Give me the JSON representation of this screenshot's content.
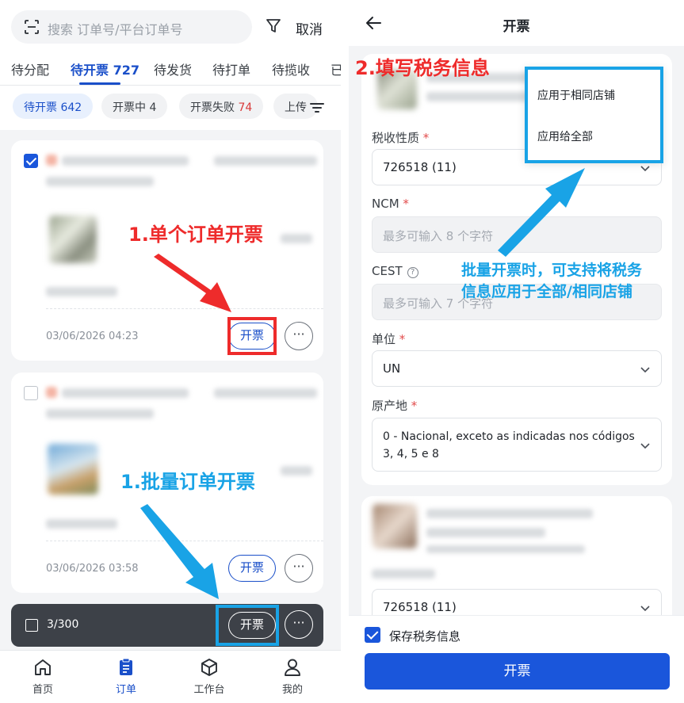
{
  "left": {
    "search": {
      "placeholder": "搜索 订单号/平台订单号",
      "cancel_label": "取消"
    },
    "tabs": [
      {
        "label": "待分配"
      },
      {
        "label": "待开票 727",
        "active": true
      },
      {
        "label": "待发货"
      },
      {
        "label": "待打单"
      },
      {
        "label": "待揽收"
      },
      {
        "label": "已"
      }
    ],
    "chips": [
      {
        "label": "待开票 642",
        "active": true
      },
      {
        "label": "开票中 4"
      },
      {
        "label": "开票失败",
        "count": "74"
      },
      {
        "label": "上传"
      }
    ],
    "orders": [
      {
        "time": "03/06/2026 04:23",
        "invoice_label": "开票",
        "more_label": "···",
        "checked": true
      },
      {
        "time": "03/06/2026 03:58",
        "invoice_label": "开票",
        "more_label": "···",
        "checked": false
      }
    ],
    "batch_bar": {
      "count": "3/300",
      "invoice_label": "开票",
      "more_label": "···"
    },
    "bottom_nav": [
      {
        "label": "首页",
        "icon": "home-icon"
      },
      {
        "label": "订单",
        "icon": "order-icon",
        "active": true
      },
      {
        "label": "工作台",
        "icon": "workbench-icon"
      },
      {
        "label": "我的",
        "icon": "profile-icon"
      }
    ],
    "annotations": {
      "single": "1.单个订单开票",
      "batch": "1.批量订单开票"
    }
  },
  "right": {
    "title": "开票",
    "annotation_title": "2.填写税务信息",
    "annotation_note_line1": "批量开票时，可支持将税务",
    "annotation_note_line2": "信息应用于全部/相同店铺",
    "popover": {
      "item1": "应用于相同店铺",
      "item2": "应用给全部"
    },
    "fields": {
      "tax_nature": {
        "label": "税收性质",
        "value": "726518 (11)"
      },
      "ncm": {
        "label": "NCM",
        "placeholder": "最多可输入 8 个字符"
      },
      "cest": {
        "label": "CEST",
        "placeholder": "最多可输入 7 个字符"
      },
      "unit": {
        "label": "单位",
        "value": "UN"
      },
      "origin": {
        "label": "原产地",
        "value": "0 - Nacional, exceto as indicadas nos códigos 3, 4, 5 e 8"
      },
      "tax_nature_2": {
        "value": "726518 (11)"
      }
    },
    "required_mark": "*",
    "save_label": "保存税务信息",
    "submit_label": "开票"
  },
  "colors": {
    "primary": "#1a56db",
    "annotation_red": "#ee2b2b",
    "annotation_blue": "#19a3e6"
  }
}
